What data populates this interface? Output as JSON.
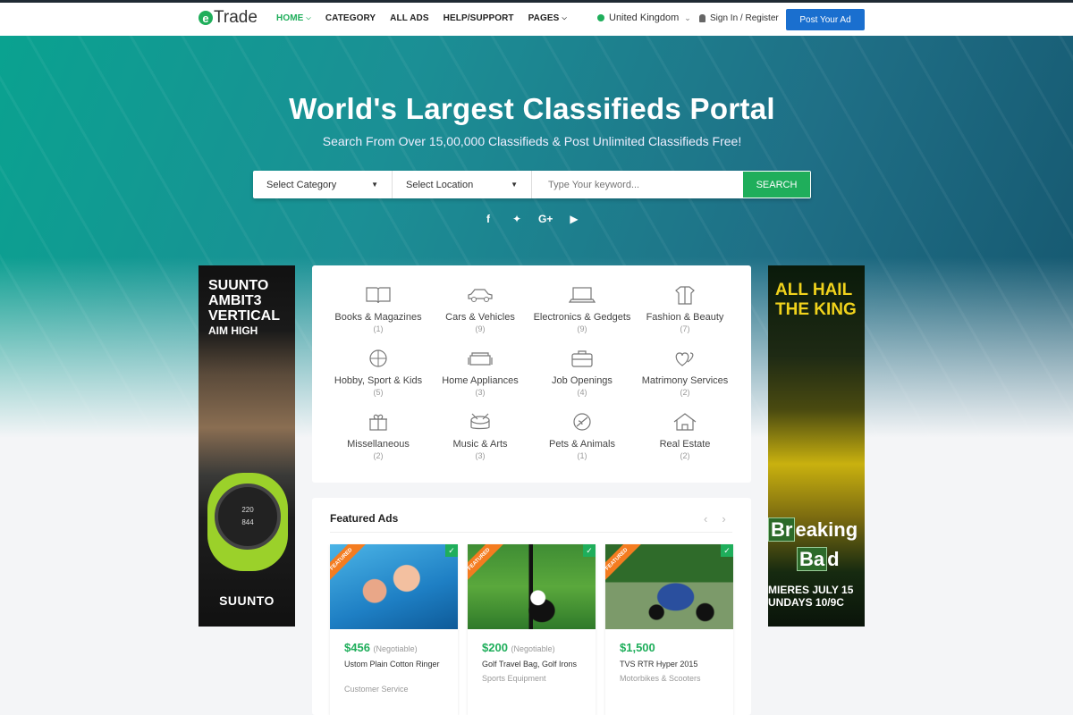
{
  "header": {
    "logo_e": "e",
    "logo_text": "Trade",
    "nav": [
      "HOME",
      "CATEGORY",
      "ALL ADS",
      "HELP/SUPPORT",
      "PAGES"
    ],
    "country": "United Kingdom",
    "signin": "Sign In / Register",
    "post_ad": "Post Your Ad"
  },
  "hero": {
    "title": "World's Largest Classifieds Portal",
    "subtitle": "Search From Over 15,00,000 Classifieds & Post Unlimited Classifieds Free!",
    "category_select": "Select Category",
    "location_select": "Select Location",
    "keyword_placeholder": "Type Your keyword...",
    "search_button": "SEARCH",
    "socials": [
      "facebook-icon",
      "twitter-icon",
      "google-plus-icon",
      "youtube-icon"
    ]
  },
  "ad_left": {
    "line1": "SUUNTO",
    "line2": "AMBIT3",
    "line3": "VERTICAL",
    "line4": "AIM HIGH",
    "watch": "220",
    "watch2": "844",
    "brand": "SUUNTO"
  },
  "ad_right": {
    "line1": "ALL HAIL",
    "line2": "THE KING",
    "br_el": "Br",
    "br_rest": "eaking",
    "bad_el": "Ba",
    "bad_rest": "d",
    "airs1": "MIERES JULY 15",
    "airs2": "UNDAYS 10/9C"
  },
  "categories": [
    {
      "name": "Books & Magazines",
      "count": "(1)",
      "icon": "book-icon"
    },
    {
      "name": "Cars & Vehicles",
      "count": "(9)",
      "icon": "car-icon"
    },
    {
      "name": "Electronics & Gedgets",
      "count": "(9)",
      "icon": "laptop-icon"
    },
    {
      "name": "Fashion & Beauty",
      "count": "(7)",
      "icon": "shirt-icon"
    },
    {
      "name": "Hobby, Sport & Kids",
      "count": "(5)",
      "icon": "ball-icon"
    },
    {
      "name": "Home Appliances",
      "count": "(3)",
      "icon": "sofa-icon"
    },
    {
      "name": "Job Openings",
      "count": "(4)",
      "icon": "briefcase-icon"
    },
    {
      "name": "Matrimony Services",
      "count": "(2)",
      "icon": "hearts-icon"
    },
    {
      "name": "Missellaneous",
      "count": "(2)",
      "icon": "gift-icon"
    },
    {
      "name": "Music & Arts",
      "count": "(3)",
      "icon": "drum-icon"
    },
    {
      "name": "Pets & Animals",
      "count": "(1)",
      "icon": "leaf-icon"
    },
    {
      "name": "Real Estate",
      "count": "(2)",
      "icon": "house-icon"
    }
  ],
  "featured": {
    "title": "Featured Ads",
    "ribbon": "FEATURED",
    "cards": [
      {
        "price": "$456",
        "neg": "(Negotiable)",
        "title": "Ustom Plain Cotton Ringer",
        "sub": "Customer Service"
      },
      {
        "price": "$200",
        "neg": "(Negotiable)",
        "title": "Golf Travel Bag, Golf Irons",
        "sub": "Sports Equipment"
      },
      {
        "price": "$1,500",
        "neg": "",
        "title": "TVS RTR Hyper 2015",
        "sub": "Motorbikes & Scooters"
      }
    ]
  }
}
